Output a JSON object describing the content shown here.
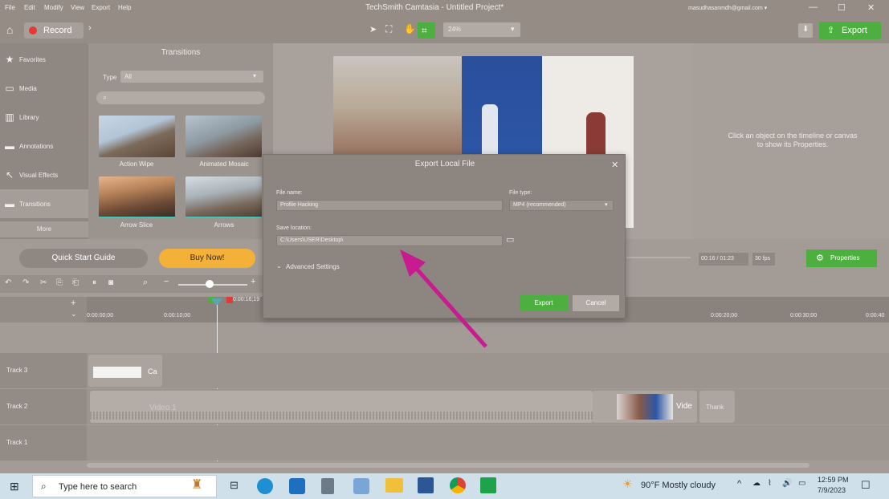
{
  "menu": {
    "items": [
      "File",
      "Edit",
      "Modify",
      "View",
      "Export",
      "Help"
    ]
  },
  "window": {
    "title": "TechSmith Camtasia - Untitled Project*",
    "account": "masudhasanmdh@gmail.com ▾",
    "minimize": "—",
    "maximize": "☐",
    "close": "✕"
  },
  "toolbar": {
    "record_label": "Record",
    "zoom_value": "24%",
    "export_label": "Export"
  },
  "sidebar": {
    "items": [
      {
        "label": "Favorites",
        "icon": "★"
      },
      {
        "label": "Media",
        "icon": "▭"
      },
      {
        "label": "Library",
        "icon": "▥"
      },
      {
        "label": "Annotations",
        "icon": "▬"
      },
      {
        "label": "Visual Effects",
        "icon": "↖"
      },
      {
        "label": "Transitions",
        "icon": "▬"
      }
    ],
    "more_label": "More"
  },
  "transitions": {
    "title": "Transitions",
    "type_label": "Type",
    "type_value": "All",
    "search_icon": "search-icon",
    "items": [
      {
        "label": "Action Wipe"
      },
      {
        "label": "Animated Mosaic"
      },
      {
        "label": "Arrow Slice"
      },
      {
        "label": "Arrows"
      }
    ]
  },
  "properties_hint": "Click an object on the timeline or canvas to show its Properties.",
  "controls": {
    "quick_start": "Quick Start Guide",
    "buy_now": "Buy Now!",
    "time": "00:16 / 01:23",
    "fps": "30 fps",
    "properties_label": "Properties"
  },
  "timeline": {
    "playhead": "0:00:16;19",
    "ticks": [
      "0:00:00;00",
      "0:00:10;00",
      "0:00:20;00",
      "0:00:30;00",
      "0:00:40"
    ],
    "tracks": [
      {
        "name": "Track 3",
        "clip": "Ca"
      },
      {
        "name": "Track 2",
        "clip": "Video 1",
        "clip2": "Vide",
        "clip3": "Thank"
      },
      {
        "name": "Track 1",
        "clip": ""
      }
    ]
  },
  "dialog": {
    "title": "Export Local File",
    "file_name_label": "File name:",
    "file_name_value": "Profile Hacking",
    "file_type_label": "File type:",
    "file_type_value": "MP4 (recommended)",
    "save_location_label": "Save location:",
    "save_location_value": "C:\\Users\\USER\\Desktop\\",
    "advanced_label": "Advanced Settings",
    "export_button": "Export",
    "cancel_button": "Cancel",
    "close": "✕"
  },
  "taskbar": {
    "search_placeholder": "Type here to search",
    "weather": "90°F  Mostly cloudy",
    "time": "12:59 PM",
    "date": "7/9/2023"
  },
  "colors": {
    "accent_green": "#4caf3f",
    "buy_orange": "#f3b13a",
    "arrow_magenta": "#c81b8f",
    "record_red": "#e53935"
  }
}
